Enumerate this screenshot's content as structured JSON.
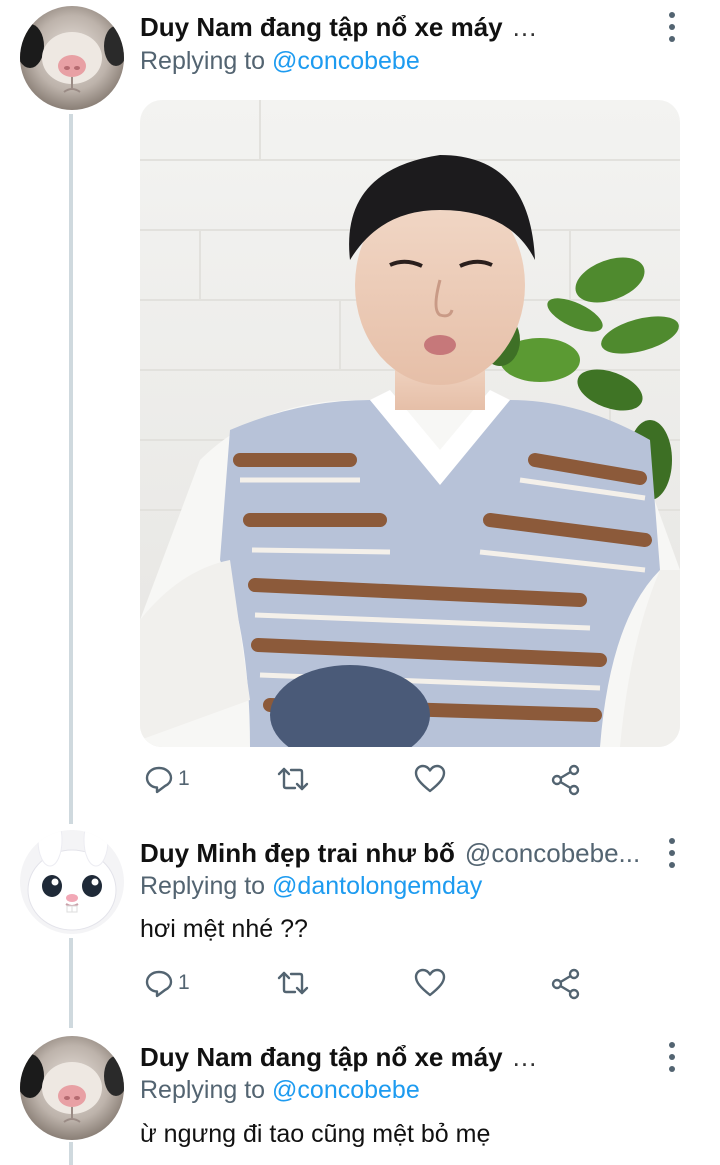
{
  "tweets": [
    {
      "author": "Duy Nam đang tập nổ xe máy",
      "handle": "",
      "ellipsis": "...",
      "reply_prefix": "Replying to ",
      "reply_to": "@concobebe",
      "text": "",
      "avatar_icon": "hamster-avatar",
      "has_media": true,
      "actions": {
        "reply_count": "1",
        "retweet_count": "",
        "like_count": ""
      }
    },
    {
      "author": "Duy Minh đẹp trai như bố",
      "handle": "@concobebe...",
      "ellipsis": "",
      "reply_prefix": "Replying to ",
      "reply_to": "@dantolongemday",
      "text": "hơi mệt nhé ??",
      "avatar_icon": "white-rabbit-avatar",
      "has_media": false,
      "actions": {
        "reply_count": "1",
        "retweet_count": "",
        "like_count": ""
      }
    },
    {
      "author": "Duy Nam đang tập nổ xe máy",
      "handle": "",
      "ellipsis": "...",
      "reply_prefix": "Replying to ",
      "reply_to": "@concobebe",
      "text": "ừ ngưng đi tao cũng mệt bỏ mẹ",
      "avatar_icon": "hamster-avatar",
      "has_media": false,
      "actions": null
    }
  ],
  "colors": {
    "link": "#1d9bf0",
    "secondary_text": "#536471",
    "thread_line": "#cfd9de"
  }
}
